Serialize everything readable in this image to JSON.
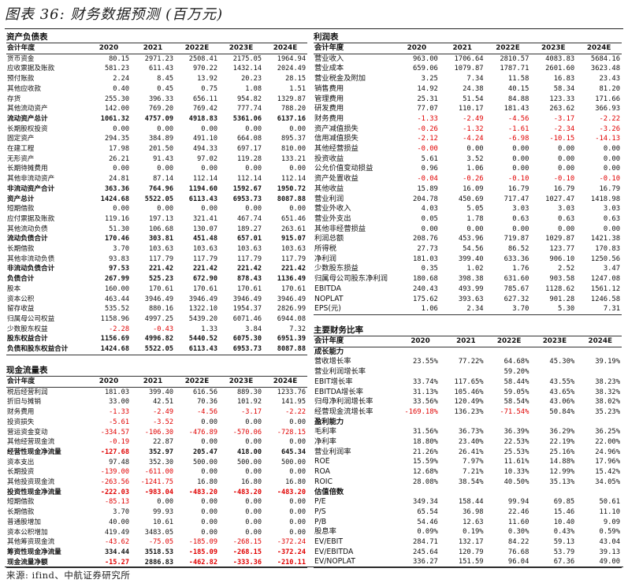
{
  "figure_title": "图表 36: 财务数据预测 (百万元)",
  "source": "来源: ifind、中航证券研究所",
  "balance": {
    "title": "资产负债表",
    "header": [
      "会计年度",
      "2020",
      "2021",
      "2022E",
      "2023E",
      "2024E"
    ],
    "rows": [
      {
        "label": "货币资金",
        "values": [
          "80.15",
          "2971.23",
          "2508.41",
          "2175.05",
          "1964.94"
        ]
      },
      {
        "label": "应收票据及账款",
        "values": [
          "581.23",
          "611.43",
          "970.22",
          "1432.14",
          "2024.49"
        ]
      },
      {
        "label": "预付账款",
        "values": [
          "2.24",
          "8.45",
          "13.92",
          "20.23",
          "28.15"
        ]
      },
      {
        "label": "其他应收款",
        "values": [
          "0.40",
          "0.45",
          "0.75",
          "1.08",
          "1.51"
        ]
      },
      {
        "label": "存货",
        "values": [
          "255.30",
          "396.33",
          "656.11",
          "954.82",
          "1329.87"
        ]
      },
      {
        "label": "其他流动资产",
        "values": [
          "142.00",
          "769.20",
          "769.42",
          "777.74",
          "788.20"
        ]
      },
      {
        "label": "流动资产总计",
        "values": [
          "1061.32",
          "4757.09",
          "4918.83",
          "5361.06",
          "6137.16"
        ],
        "bold": true
      },
      {
        "label": "长期股权投资",
        "values": [
          "0.00",
          "0.00",
          "0.00",
          "0.00",
          "0.00"
        ]
      },
      {
        "label": "固定资产",
        "values": [
          "294.35",
          "384.89",
          "491.10",
          "664.08",
          "895.37"
        ]
      },
      {
        "label": "在建工程",
        "values": [
          "17.98",
          "201.50",
          "494.33",
          "697.17",
          "810.00"
        ]
      },
      {
        "label": "无形资产",
        "values": [
          "26.21",
          "91.43",
          "97.02",
          "119.28",
          "133.21"
        ]
      },
      {
        "label": "长期待摊费用",
        "values": [
          "0.00",
          "0.00",
          "0.00",
          "0.00",
          "0.00"
        ]
      },
      {
        "label": "其他非流动资产",
        "values": [
          "24.81",
          "87.14",
          "112.14",
          "112.14",
          "112.14"
        ]
      },
      {
        "label": "非流动资产合计",
        "values": [
          "363.36",
          "764.96",
          "1194.60",
          "1592.67",
          "1950.72"
        ],
        "bold": true
      },
      {
        "label": "资产总计",
        "values": [
          "1424.68",
          "5522.05",
          "6113.43",
          "6953.73",
          "8087.88"
        ],
        "bold": true
      },
      {
        "label": "短期借款",
        "values": [
          "0.00",
          "0.00",
          "0.00",
          "0.00",
          "0.00"
        ]
      },
      {
        "label": "应付票据及账款",
        "values": [
          "119.16",
          "197.13",
          "321.41",
          "467.74",
          "651.46"
        ]
      },
      {
        "label": "其他流动负债",
        "values": [
          "51.30",
          "106.68",
          "130.07",
          "189.27",
          "263.61"
        ]
      },
      {
        "label": "流动负债合计",
        "values": [
          "170.46",
          "303.81",
          "451.48",
          "657.01",
          "915.07"
        ],
        "bold": true
      },
      {
        "label": "长期借款",
        "values": [
          "3.70",
          "103.63",
          "103.63",
          "103.63",
          "103.63"
        ]
      },
      {
        "label": "其他非流动负债",
        "values": [
          "93.83",
          "117.79",
          "117.79",
          "117.79",
          "117.79"
        ]
      },
      {
        "label": "非流动负债合计",
        "values": [
          "97.53",
          "221.42",
          "221.42",
          "221.42",
          "221.42"
        ],
        "bold": true
      },
      {
        "label": "负债合计",
        "values": [
          "267.99",
          "525.23",
          "672.90",
          "878.43",
          "1136.49"
        ],
        "bold": true
      },
      {
        "label": "股本",
        "values": [
          "160.00",
          "170.61",
          "170.61",
          "170.61",
          "170.61"
        ]
      },
      {
        "label": "资本公积",
        "values": [
          "463.44",
          "3946.49",
          "3946.49",
          "3946.49",
          "3946.49"
        ]
      },
      {
        "label": "留存收益",
        "values": [
          "535.52",
          "880.16",
          "1322.10",
          "1954.37",
          "2826.99"
        ]
      },
      {
        "label": "归属母公司权益",
        "values": [
          "1158.96",
          "4997.25",
          "5439.20",
          "6071.46",
          "6944.08"
        ]
      },
      {
        "label": "少数股东权益",
        "values": [
          "-2.28",
          "-0.43",
          "1.33",
          "3.84",
          "7.32"
        ]
      },
      {
        "label": "股东权益合计",
        "values": [
          "1156.69",
          "4996.82",
          "5440.52",
          "6075.30",
          "6951.39"
        ],
        "bold": true
      },
      {
        "label": "负债和股东权益合计",
        "values": [
          "1424.68",
          "5522.05",
          "6113.43",
          "6953.73",
          "8087.88"
        ],
        "bold": true
      }
    ]
  },
  "cashflow": {
    "title": "现金流量表",
    "header": [
      "会计年度",
      "2020",
      "2021",
      "2022E",
      "2023E",
      "2024E"
    ],
    "rows": [
      {
        "label": "税后经营利润",
        "values": [
          "181.03",
          "399.40",
          "616.56",
          "889.30",
          "1233.76"
        ]
      },
      {
        "label": "折旧与摊销",
        "values": [
          "33.00",
          "42.51",
          "70.36",
          "101.92",
          "141.95"
        ]
      },
      {
        "label": "财务费用",
        "values": [
          "-1.33",
          "-2.49",
          "-4.56",
          "-3.17",
          "-2.22"
        ]
      },
      {
        "label": "投资损失",
        "values": [
          "-5.61",
          "-3.52",
          "0.00",
          "0.00",
          "0.00"
        ]
      },
      {
        "label": "营运资金变动",
        "values": [
          "-334.57",
          "-106.30",
          "-476.89",
          "-570.06",
          "-728.15"
        ]
      },
      {
        "label": "其他经营现金流",
        "values": [
          "-0.19",
          "22.87",
          "0.00",
          "0.00",
          "0.00"
        ]
      },
      {
        "label": "经营性现金净流量",
        "values": [
          "-127.68",
          "352.97",
          "205.47",
          "418.00",
          "645.34"
        ],
        "bold": true
      },
      {
        "label": "资本支出",
        "values": [
          "97.48",
          "352.30",
          "500.00",
          "500.00",
          "500.00"
        ]
      },
      {
        "label": "长期投资",
        "values": [
          "-139.00",
          "-611.00",
          "0.00",
          "0.00",
          "0.00"
        ]
      },
      {
        "label": "其他投资现金流",
        "values": [
          "-263.56",
          "-1241.75",
          "16.80",
          "16.80",
          "16.80"
        ]
      },
      {
        "label": "投资性现金净流量",
        "values": [
          "-222.03",
          "-983.04",
          "-483.20",
          "-483.20",
          "-483.20"
        ],
        "bold": true
      },
      {
        "label": "短期借款",
        "values": [
          "-85.13",
          "0.00",
          "0.00",
          "0.00",
          "0.00"
        ]
      },
      {
        "label": "长期借款",
        "values": [
          "3.70",
          "99.93",
          "0.00",
          "0.00",
          "0.00"
        ]
      },
      {
        "label": "普通股增加",
        "values": [
          "40.00",
          "10.61",
          "0.00",
          "0.00",
          "0.00"
        ]
      },
      {
        "label": "资本公积增加",
        "values": [
          "419.49",
          "3483.05",
          "0.00",
          "0.00",
          "0.00"
        ]
      },
      {
        "label": "其他筹资现金流",
        "values": [
          "-43.62",
          "-75.05",
          "-185.09",
          "-268.15",
          "-372.24"
        ]
      },
      {
        "label": "筹资性现金净流量",
        "values": [
          "334.44",
          "3518.53",
          "-185.09",
          "-268.15",
          "-372.24"
        ],
        "bold": true
      },
      {
        "label": "现金流量净额",
        "values": [
          "-15.27",
          "2886.83",
          "-462.82",
          "-333.36",
          "-210.11"
        ],
        "bold": true
      }
    ]
  },
  "income": {
    "title": "利润表",
    "header": [
      "会计年度",
      "2020",
      "2021",
      "2022E",
      "2023E",
      "2024E"
    ],
    "rows": [
      {
        "label": "营业收入",
        "values": [
          "963.00",
          "1706.64",
          "2810.57",
          "4083.83",
          "5684.16"
        ]
      },
      {
        "label": "营业成本",
        "values": [
          "659.06",
          "1079.87",
          "1787.71",
          "2601.60",
          "3623.48"
        ]
      },
      {
        "label": "营业税金及附加",
        "values": [
          "3.25",
          "7.34",
          "11.58",
          "16.83",
          "23.43"
        ]
      },
      {
        "label": "销售费用",
        "values": [
          "14.92",
          "24.38",
          "40.15",
          "58.34",
          "81.20"
        ]
      },
      {
        "label": "管理费用",
        "values": [
          "25.31",
          "51.54",
          "84.88",
          "123.33",
          "171.66"
        ]
      },
      {
        "label": "研发费用",
        "values": [
          "77.07",
          "110.17",
          "181.43",
          "263.62",
          "366.93"
        ]
      },
      {
        "label": "财务费用",
        "values": [
          "-1.33",
          "-2.49",
          "-4.56",
          "-3.17",
          "-2.22"
        ]
      },
      {
        "label": "资产减值损失",
        "values": [
          "-0.26",
          "-1.32",
          "-1.61",
          "-2.34",
          "-3.26"
        ]
      },
      {
        "label": "信用减值损失",
        "values": [
          "-2.12",
          "-4.24",
          "-6.98",
          "-10.15",
          "-14.13"
        ]
      },
      {
        "label": "其他经营损益",
        "values": [
          "-0.00",
          "0.00",
          "0.00",
          "0.00",
          "0.00"
        ]
      },
      {
        "label": "投资收益",
        "values": [
          "5.61",
          "3.52",
          "0.00",
          "0.00",
          "0.00"
        ]
      },
      {
        "label": "公允价值变动损益",
        "values": [
          "0.96",
          "1.06",
          "0.00",
          "0.00",
          "0.00"
        ]
      },
      {
        "label": "资产处置收益",
        "values": [
          "-0.04",
          "-0.26",
          "-0.10",
          "-0.10",
          "-0.10"
        ]
      },
      {
        "label": "其他收益",
        "values": [
          "15.89",
          "16.09",
          "16.79",
          "16.79",
          "16.79"
        ]
      },
      {
        "label": "营业利润",
        "values": [
          "204.78",
          "450.69",
          "717.47",
          "1027.47",
          "1418.98"
        ]
      },
      {
        "label": "营业外收入",
        "values": [
          "4.03",
          "5.05",
          "3.03",
          "3.03",
          "3.03"
        ]
      },
      {
        "label": "营业外支出",
        "values": [
          "0.05",
          "1.78",
          "0.63",
          "0.63",
          "0.63"
        ]
      },
      {
        "label": "其他非经营损益",
        "values": [
          "0.00",
          "0.00",
          "0.00",
          "0.00",
          "0.00"
        ]
      },
      {
        "label": "利润总额",
        "values": [
          "208.76",
          "453.96",
          "719.87",
          "1029.87",
          "1421.38"
        ]
      },
      {
        "label": "所得税",
        "values": [
          "27.73",
          "54.56",
          "86.52",
          "123.77",
          "170.83"
        ]
      },
      {
        "label": "净利润",
        "values": [
          "181.03",
          "399.40",
          "633.36",
          "906.10",
          "1250.56"
        ]
      },
      {
        "label": "少数股东损益",
        "values": [
          "0.35",
          "1.02",
          "1.76",
          "2.52",
          "3.47"
        ]
      },
      {
        "label": "归属母公司股东净利润",
        "values": [
          "180.68",
          "398.38",
          "631.60",
          "903.58",
          "1247.08"
        ]
      },
      {
        "label": "EBITDA",
        "values": [
          "240.43",
          "493.99",
          "785.67",
          "1128.62",
          "1561.12"
        ]
      },
      {
        "label": "NOPLAT",
        "values": [
          "175.62",
          "393.63",
          "627.32",
          "901.28",
          "1246.58"
        ]
      },
      {
        "label": "EPS(元)",
        "values": [
          "1.06",
          "2.34",
          "3.70",
          "5.30",
          "7.31"
        ]
      }
    ]
  },
  "ratios": {
    "title": "主要财务比率",
    "header": [
      "会计年度",
      "2020",
      "2021",
      "2022E",
      "2023E",
      "2024E"
    ],
    "rows": [
      {
        "label": "成长能力",
        "values": [
          "",
          "",
          "",
          "",
          ""
        ],
        "section": true
      },
      {
        "label": "营收增长率",
        "values": [
          "23.55%",
          "77.22%",
          "64.68%",
          "45.30%",
          "39.19%"
        ]
      },
      {
        "label": "营业利润增长率",
        "values": [
          "",
          "",
          "59.20%",
          "",
          ""
        ]
      },
      {
        "label": "EBIT增长率",
        "values": [
          "33.74%",
          "117.65%",
          "58.44%",
          "43.55%",
          "38.23%"
        ]
      },
      {
        "label": "EBITDA增长率",
        "values": [
          "31.13%",
          "105.46%",
          "59.05%",
          "43.65%",
          "38.32%"
        ]
      },
      {
        "label": "归母净利润增长率",
        "values": [
          "33.56%",
          "120.49%",
          "58.54%",
          "43.06%",
          "38.02%"
        ]
      },
      {
        "label": "经营现金流增长率",
        "values": [
          "-169.18%",
          "136.23%",
          "-71.54%",
          "50.84%",
          "35.23%"
        ]
      },
      {
        "label": "盈利能力",
        "values": [
          "",
          "",
          "",
          "",
          ""
        ],
        "section": true
      },
      {
        "label": "毛利率",
        "values": [
          "31.56%",
          "36.73%",
          "36.39%",
          "36.29%",
          "36.25%"
        ]
      },
      {
        "label": "净利率",
        "values": [
          "18.80%",
          "23.40%",
          "22.53%",
          "22.19%",
          "22.00%"
        ]
      },
      {
        "label": "营业利润率",
        "values": [
          "21.26%",
          "26.41%",
          "25.53%",
          "25.16%",
          "24.96%"
        ]
      },
      {
        "label": "ROE",
        "values": [
          "15.59%",
          "7.97%",
          "11.61%",
          "14.88%",
          "17.96%"
        ]
      },
      {
        "label": "ROA",
        "values": [
          "12.68%",
          "7.21%",
          "10.33%",
          "12.99%",
          "15.42%"
        ]
      },
      {
        "label": "ROIC",
        "values": [
          "28.08%",
          "38.54%",
          "40.50%",
          "35.13%",
          "34.05%"
        ]
      },
      {
        "label": "估值倍数",
        "values": [
          "",
          "",
          "",
          "",
          ""
        ],
        "section": true
      },
      {
        "label": "P/E",
        "values": [
          "349.34",
          "158.44",
          "99.94",
          "69.85",
          "50.61"
        ]
      },
      {
        "label": "P/S",
        "values": [
          "65.54",
          "36.98",
          "22.46",
          "15.46",
          "11.10"
        ]
      },
      {
        "label": "P/B",
        "values": [
          "54.46",
          "12.63",
          "11.60",
          "10.40",
          "9.09"
        ]
      },
      {
        "label": "股息率",
        "values": [
          "0.09%",
          "0.19%",
          "0.30%",
          "0.43%",
          "0.59%"
        ]
      },
      {
        "label": "EV/EBIT",
        "values": [
          "284.71",
          "132.17",
          "84.22",
          "59.13",
          "43.04"
        ]
      },
      {
        "label": "EV/EBITDA",
        "values": [
          "245.64",
          "120.79",
          "76.68",
          "53.79",
          "39.13"
        ]
      },
      {
        "label": "EV/NOPLAT",
        "values": [
          "336.27",
          "151.59",
          "96.04",
          "67.36",
          "49.00"
        ]
      }
    ]
  },
  "colors": {
    "negative": "#e00000",
    "text": "#111111",
    "rule": "#333333"
  }
}
